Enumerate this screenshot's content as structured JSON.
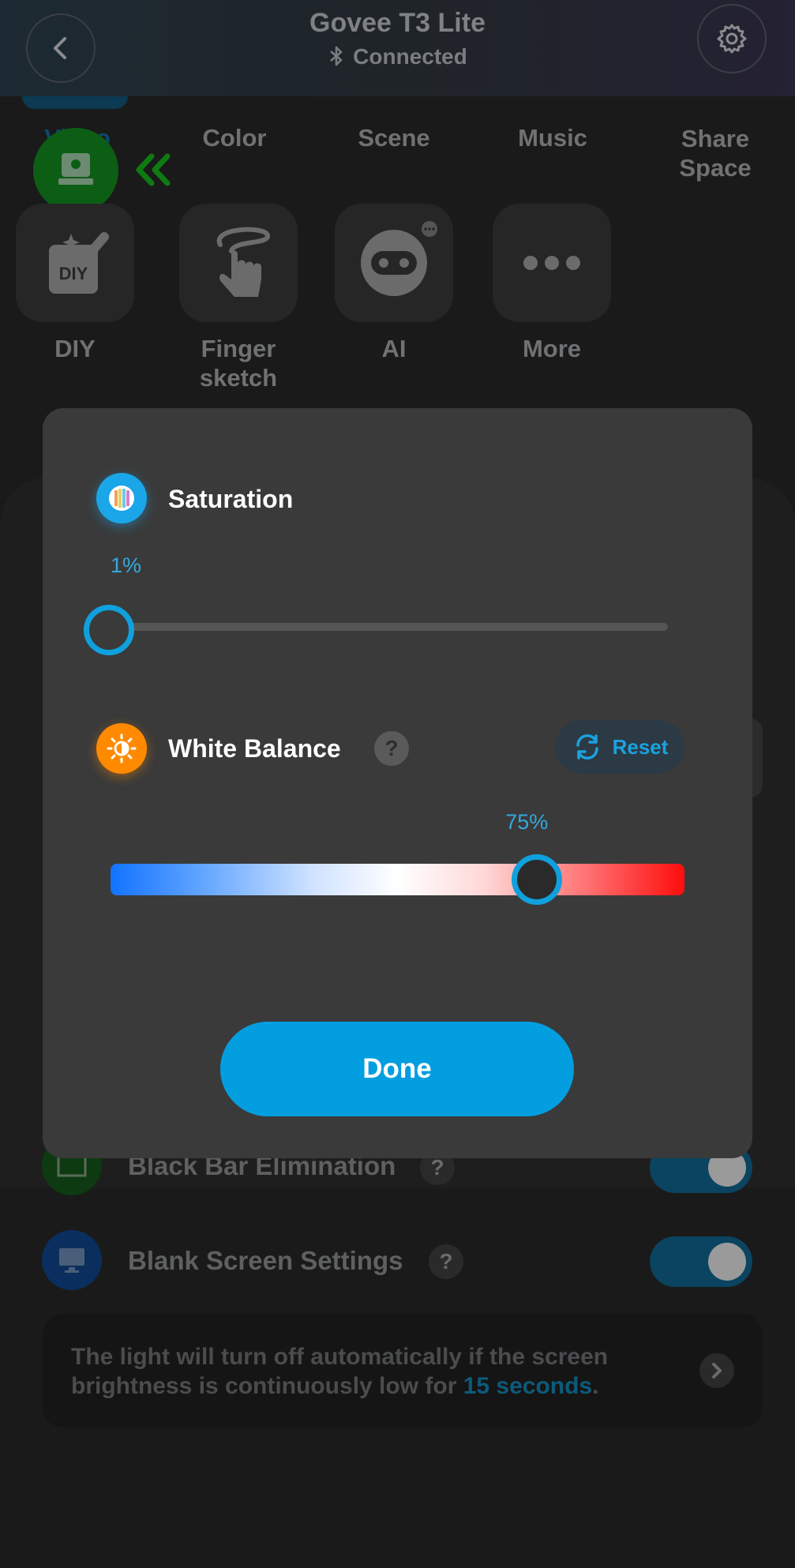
{
  "header": {
    "title": "Govee T3 Lite",
    "status": "Connected"
  },
  "tabs": [
    {
      "label": "Video"
    },
    {
      "label": "Color"
    },
    {
      "label": "Scene"
    },
    {
      "label": "Music"
    },
    {
      "label": "Share\nSpace"
    }
  ],
  "tools": [
    {
      "label": "DIY"
    },
    {
      "label": "Finger\nsketch"
    },
    {
      "label": "AI"
    },
    {
      "label": "More"
    }
  ],
  "settings": {
    "black_bar": "Black Bar Elimination",
    "blank_screen": "Blank Screen Settings",
    "info_prefix": "The light will turn off automatically if the screen brightness is continuously low for ",
    "info_highlight": "15 seconds",
    "info_suffix": "."
  },
  "modal": {
    "saturation": {
      "title": "Saturation",
      "value_label": "1%",
      "value": 1
    },
    "white_balance": {
      "title": "White Balance",
      "value_label": "75%",
      "value": 75,
      "reset_label": "Reset"
    },
    "done_label": "Done"
  },
  "colors": {
    "accent": "#039ee0",
    "modal_bg": "#3a3a3a",
    "white_balance_icon": "#ff8a00",
    "saturation_icon": "#1aa6e8"
  }
}
